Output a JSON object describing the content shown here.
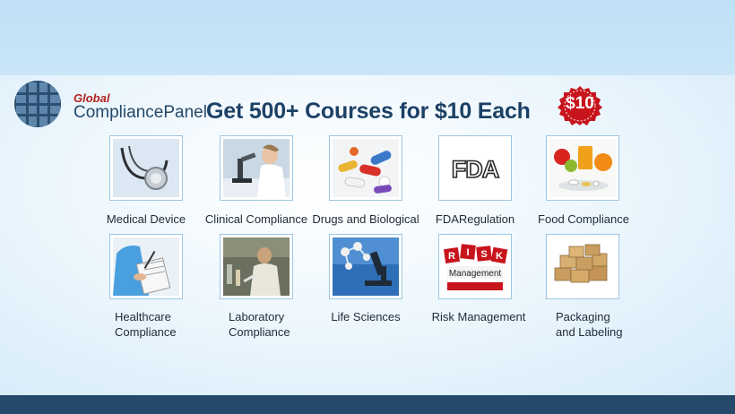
{
  "brand": {
    "global": "Global",
    "name": "CompliancePanel"
  },
  "headline": "Get 500+ Courses for $10 Each",
  "price_badge": "$10",
  "colors": {
    "brand_navy": "#1c4166",
    "brand_red": "#c8141c",
    "tile_border": "#9cc6e4",
    "footer": "#24496b"
  },
  "categories": [
    {
      "icon": "stethoscope-icon",
      "label": "Medical Device"
    },
    {
      "icon": "microscope-researcher-icon",
      "label": "Clinical Compliance"
    },
    {
      "icon": "pills-icon",
      "label": "Drugs and Biological"
    },
    {
      "icon": "fda-logo-icon",
      "label": "FDARegulation"
    },
    {
      "icon": "fruits-juice-icon",
      "label": "Food Compliance"
    },
    {
      "icon": "nurse-clipboard-icon",
      "label": "Healthcare",
      "label2": "Compliance"
    },
    {
      "icon": "lab-scientist-icon",
      "label": "Laboratory",
      "label2": "Compliance"
    },
    {
      "icon": "molecule-microscope-icon",
      "label": "Life Sciences"
    },
    {
      "icon": "risk-dice-icon",
      "label": "Risk Management",
      "badge_text": "Management",
      "dice_letters": [
        "R",
        "I",
        "S",
        "K"
      ]
    },
    {
      "icon": "cardboard-boxes-icon",
      "label": "Packaging",
      "label2": "and Labeling"
    }
  ]
}
